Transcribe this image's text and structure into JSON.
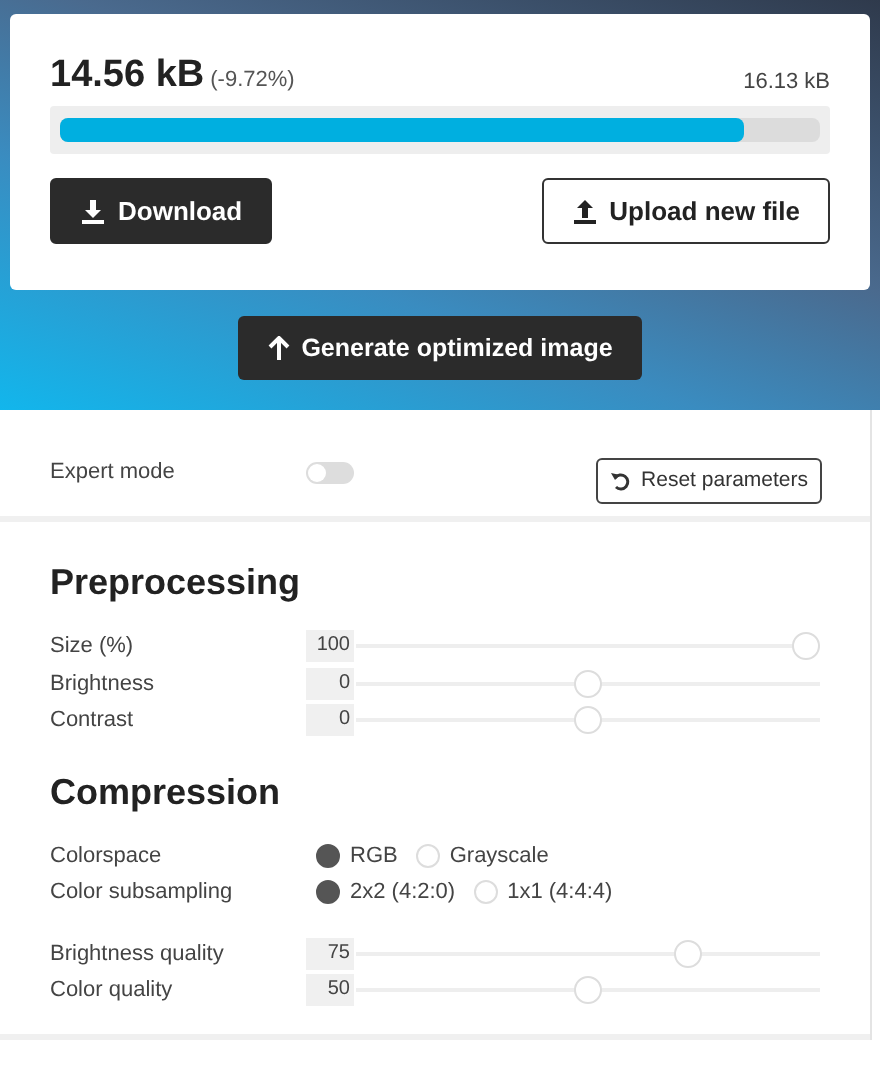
{
  "result": {
    "size": "14.56 kB",
    "change": "(-9.72%)",
    "original": "16.13 kB",
    "level": 0.9
  },
  "actions": [
    {
      "kind": "download",
      "label": "Download"
    },
    {
      "kind": "upload",
      "label": "Upload new file"
    }
  ],
  "generate_button": "Generate optimized image",
  "expert_mode": {
    "label": "Expert mode",
    "on": false
  },
  "reset_button": "Reset parameters",
  "sections": [
    {
      "title": "Preprocessing",
      "rows": [
        {
          "kind": "slider",
          "label": "Size (%)",
          "value": "100",
          "level": 1.0
        },
        {
          "kind": "slider",
          "label": "Brightness",
          "value": "0",
          "level": 0.5
        },
        {
          "kind": "slider",
          "label": "Contrast",
          "value": "0",
          "level": 0.5
        }
      ]
    },
    {
      "title": "Compression",
      "rows": [
        {
          "kind": "radio",
          "label": "Colorspace",
          "options": [
            {
              "label": "RGB",
              "selected": true
            },
            {
              "label": "Grayscale",
              "selected": false
            }
          ]
        },
        {
          "kind": "radio",
          "label": "Color subsampling",
          "options": [
            {
              "label": "2x2 (4:2:0)",
              "selected": true
            },
            {
              "label": "1x1 (4:4:4)",
              "selected": false
            }
          ]
        },
        {
          "kind": "gap"
        },
        {
          "kind": "slider",
          "label": "Brightness quality",
          "value": "75",
          "level": 0.73
        },
        {
          "kind": "slider",
          "label": "Color quality",
          "value": "50",
          "level": 0.5
        }
      ]
    }
  ]
}
